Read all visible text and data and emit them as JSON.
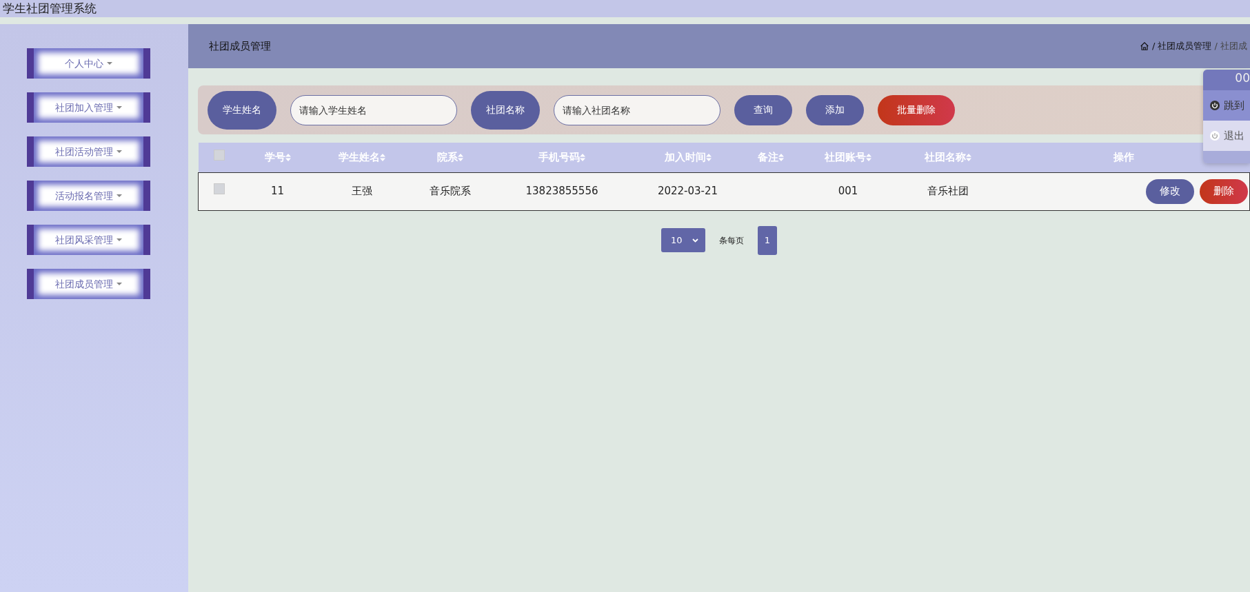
{
  "app_title": "学生社团管理系统",
  "sidebar": {
    "items": [
      {
        "label": "个人中心"
      },
      {
        "label": "社团加入管理"
      },
      {
        "label": "社团活动管理"
      },
      {
        "label": "活动报名管理"
      },
      {
        "label": "社团风采管理"
      },
      {
        "label": "社团成员管理"
      }
    ]
  },
  "page_title": "社团成员管理",
  "breadcrumb": [
    "/ 社团成员管理",
    "/ 社团成"
  ],
  "search": {
    "fields": [
      {
        "label": "学生姓名",
        "placeholder": "请输入学生姓名"
      },
      {
        "label": "社团名称",
        "placeholder": "请输入社团名称"
      }
    ],
    "buttons": [
      {
        "label": "查询",
        "kind": "primary"
      },
      {
        "label": "添加",
        "kind": "primary"
      },
      {
        "label": "批量删除",
        "kind": "danger"
      }
    ]
  },
  "table": {
    "select_all": {
      "checked": false
    },
    "columns": [
      {
        "label": "学号",
        "sortable": true
      },
      {
        "label": "学生姓名",
        "sortable": true
      },
      {
        "label": "院系",
        "sortable": true
      },
      {
        "label": "手机号码",
        "sortable": true
      },
      {
        "label": "加入时间",
        "sortable": true
      },
      {
        "label": "备注",
        "sortable": true
      },
      {
        "label": "社团账号",
        "sortable": true
      },
      {
        "label": "社团名称",
        "sortable": true
      },
      {
        "label": "操作",
        "sortable": false
      }
    ],
    "rows": [
      {
        "checked": false,
        "cells": [
          "11",
          "王强",
          "音乐院系",
          "13823855556",
          "2022-03-21",
          "",
          "001",
          "音乐社团"
        ],
        "actions": [
          {
            "label": "修改",
            "kind": "primary"
          },
          {
            "label": "删除",
            "kind": "danger"
          }
        ]
      }
    ]
  },
  "pagination": {
    "page_size": "10",
    "per_page_label": "条每页",
    "pages": [
      {
        "label": "1",
        "selected": true
      }
    ]
  },
  "user_menu": {
    "header": "00",
    "items": [
      {
        "label": "跳到",
        "highlighted": true
      },
      {
        "label": "退出",
        "highlighted": false
      }
    ]
  }
}
